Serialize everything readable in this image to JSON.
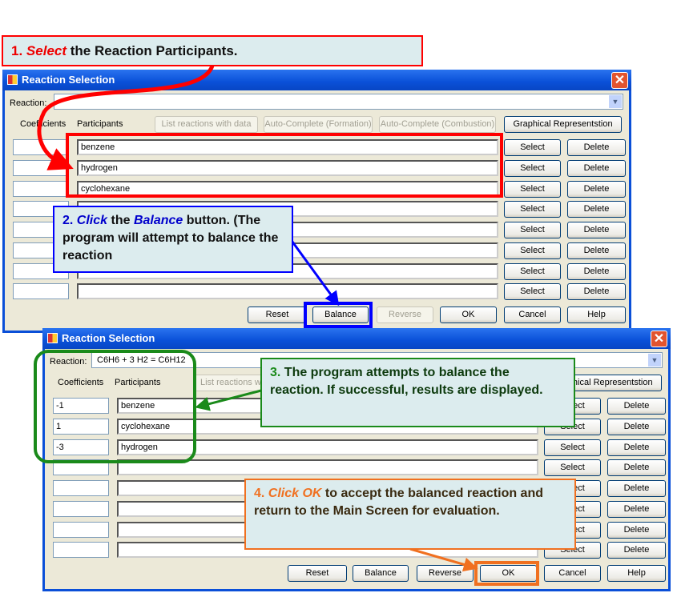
{
  "callouts": {
    "c1": {
      "num": "1.",
      "em": "Select",
      "rest": " the Reaction Participants."
    },
    "c2": {
      "num": "2.",
      "em": "Click",
      "mid": " the ",
      "em2": "Balance",
      "rest": " button. (The program will attempt to balance the reaction"
    },
    "c3": {
      "num": "3.",
      "rest": " The program attempts to balance the reaction. If successful, results are displayed."
    },
    "c4": {
      "num": "4.",
      "em": "Click OK",
      "rest": " to accept the balanced reaction and return to the Main Screen for evaluation."
    }
  },
  "colors": {
    "step1": "#ff0000",
    "step2": "#0000ff",
    "step3": "#1a8a1a",
    "step4": "#f07020"
  },
  "dialog1": {
    "title": "Reaction Selection",
    "reaction_label": "Reaction:",
    "reaction_value": "",
    "coef_header": "Coefficients",
    "part_header": "Participants",
    "top_buttons": [
      "List reactions with data",
      "Auto-Complete (Formation)",
      "Auto-Complete (Combustion)",
      "Graphical Representstion"
    ],
    "rows": [
      {
        "coef": "",
        "part": "benzene"
      },
      {
        "coef": "",
        "part": "hydrogen"
      },
      {
        "coef": "",
        "part": "cyclohexane"
      },
      {
        "coef": "",
        "part": ""
      },
      {
        "coef": "",
        "part": ""
      },
      {
        "coef": "",
        "part": ""
      },
      {
        "coef": "",
        "part": ""
      },
      {
        "coef": "",
        "part": ""
      }
    ],
    "select_label": "Select",
    "delete_label": "Delete",
    "bottom_buttons": [
      "Reset",
      "Balance",
      "Reverse",
      "OK",
      "Cancel",
      "Help"
    ]
  },
  "dialog2": {
    "title": "Reaction Selection",
    "reaction_label": "Reaction:",
    "reaction_value": "C6H6 + 3 H2 =  C6H12",
    "coef_header": "Coefficients",
    "part_header": "Participants",
    "top_buttons": [
      "List reactions with data",
      "Graphical Representstion"
    ],
    "rows": [
      {
        "coef": "-1",
        "part": "benzene"
      },
      {
        "coef": "1",
        "part": "cyclohexane"
      },
      {
        "coef": "-3",
        "part": "hydrogen"
      },
      {
        "coef": "",
        "part": ""
      },
      {
        "coef": "",
        "part": ""
      },
      {
        "coef": "",
        "part": ""
      },
      {
        "coef": "",
        "part": ""
      },
      {
        "coef": "",
        "part": ""
      }
    ],
    "select_label": "Select",
    "delete_label": "Delete",
    "bottom_buttons": [
      "Reset",
      "Balance",
      "Reverse",
      "OK",
      "Cancel",
      "Help"
    ]
  }
}
